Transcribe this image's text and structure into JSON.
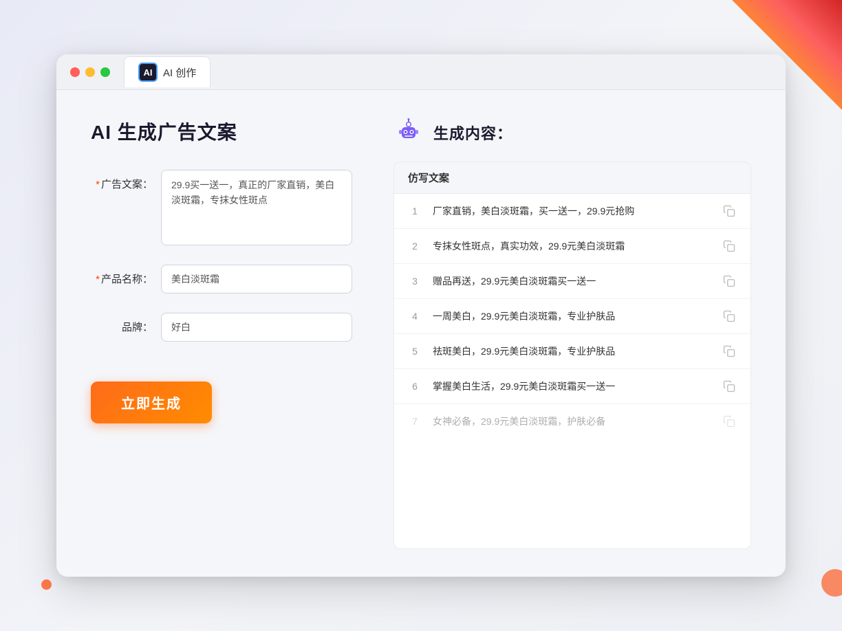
{
  "window": {
    "tab_label": "AI 创作",
    "ai_icon_text": "AI"
  },
  "left_panel": {
    "page_title": "AI 生成广告文案",
    "form": {
      "ad_copy_label": "广告文案：",
      "ad_copy_required": true,
      "ad_copy_value": "29.9买一送一，真正的厂家直销，美白淡斑霜，专抹女性斑点",
      "product_name_label": "产品名称：",
      "product_name_required": true,
      "product_name_value": "美白淡斑霜",
      "brand_label": "品牌：",
      "brand_required": false,
      "brand_value": "好白",
      "generate_btn_label": "立即生成"
    }
  },
  "right_panel": {
    "result_title": "生成内容：",
    "table_header": "仿写文案",
    "results": [
      {
        "num": "1",
        "text": "厂家直销，美白淡斑霜，买一送一，29.9元抢购",
        "muted": false
      },
      {
        "num": "2",
        "text": "专抹女性斑点，真实功效，29.9元美白淡斑霜",
        "muted": false
      },
      {
        "num": "3",
        "text": "赠品再送，29.9元美白淡斑霜买一送一",
        "muted": false
      },
      {
        "num": "4",
        "text": "一周美白，29.9元美白淡斑霜，专业护肤品",
        "muted": false
      },
      {
        "num": "5",
        "text": "祛斑美白，29.9元美白淡斑霜，专业护肤品",
        "muted": false
      },
      {
        "num": "6",
        "text": "掌握美白生活，29.9元美白淡斑霜买一送一",
        "muted": false
      },
      {
        "num": "7",
        "text": "女神必备，29.9元美白淡斑霜，护肤必备",
        "muted": true
      }
    ]
  }
}
